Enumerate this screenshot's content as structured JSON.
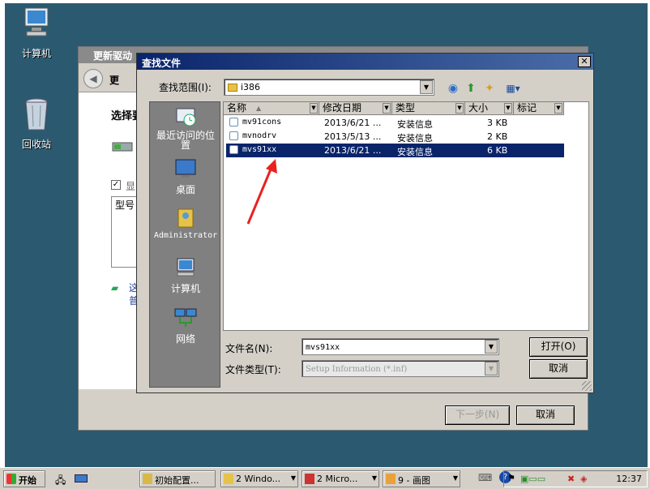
{
  "desktop": {
    "icons": [
      {
        "label": "计算机",
        "icon": "computer-icon"
      },
      {
        "label": "回收站",
        "icon": "recycle-bin-icon"
      }
    ]
  },
  "wizard": {
    "title": "更新驱动",
    "header_text": "更",
    "section_title": "选择要",
    "checkbox_label": "显",
    "list_header": "型号",
    "next_button": "下一步(N)",
    "cancel_button": "取消",
    "link_text": "这",
    "link_text2": "普"
  },
  "dialog": {
    "title": "查找文件",
    "lookin_label": "查找范围(I):",
    "lookin_value": "i386",
    "places": [
      {
        "label": "最近访问的位置",
        "icon": "recent-places-icon"
      },
      {
        "label": "桌面",
        "icon": "desktop-icon"
      },
      {
        "label": "Administrator",
        "icon": "user-folder-icon"
      },
      {
        "label": "计算机",
        "icon": "computer-icon"
      },
      {
        "label": "网络",
        "icon": "network-icon"
      }
    ],
    "columns": [
      "名称",
      "修改日期",
      "类型",
      "大小",
      "标记"
    ],
    "files": [
      {
        "name": "mv91cons",
        "date": "2013/6/21 ...",
        "type": "安装信息",
        "size": "3 KB",
        "selected": false
      },
      {
        "name": "mvnodrv",
        "date": "2013/5/13 ...",
        "type": "安装信息",
        "size": "2 KB",
        "selected": false
      },
      {
        "name": "mvs91xx",
        "date": "2013/6/21 ...",
        "type": "安装信息",
        "size": "6 KB",
        "selected": true
      }
    ],
    "filename_label": "文件名(N):",
    "filename_value": "mvs91xx",
    "filetype_label": "文件类型(T):",
    "filetype_value": "Setup Information (*.inf)",
    "open_button": "打开(O)",
    "cancel_button": "取消",
    "close_glyph": "✕"
  },
  "taskbar": {
    "start_label": "开始",
    "tasks": [
      {
        "label": "初始配置..."
      },
      {
        "label": "2 Windo..."
      },
      {
        "label": "2 Micro..."
      },
      {
        "label": "9 - 画图"
      }
    ],
    "clock": "12:37"
  },
  "colors": {
    "desktop": "#2b5a70",
    "title_active": "#0a246a",
    "selection": "#0a246a",
    "annotation_arrow": "#e8231f"
  }
}
